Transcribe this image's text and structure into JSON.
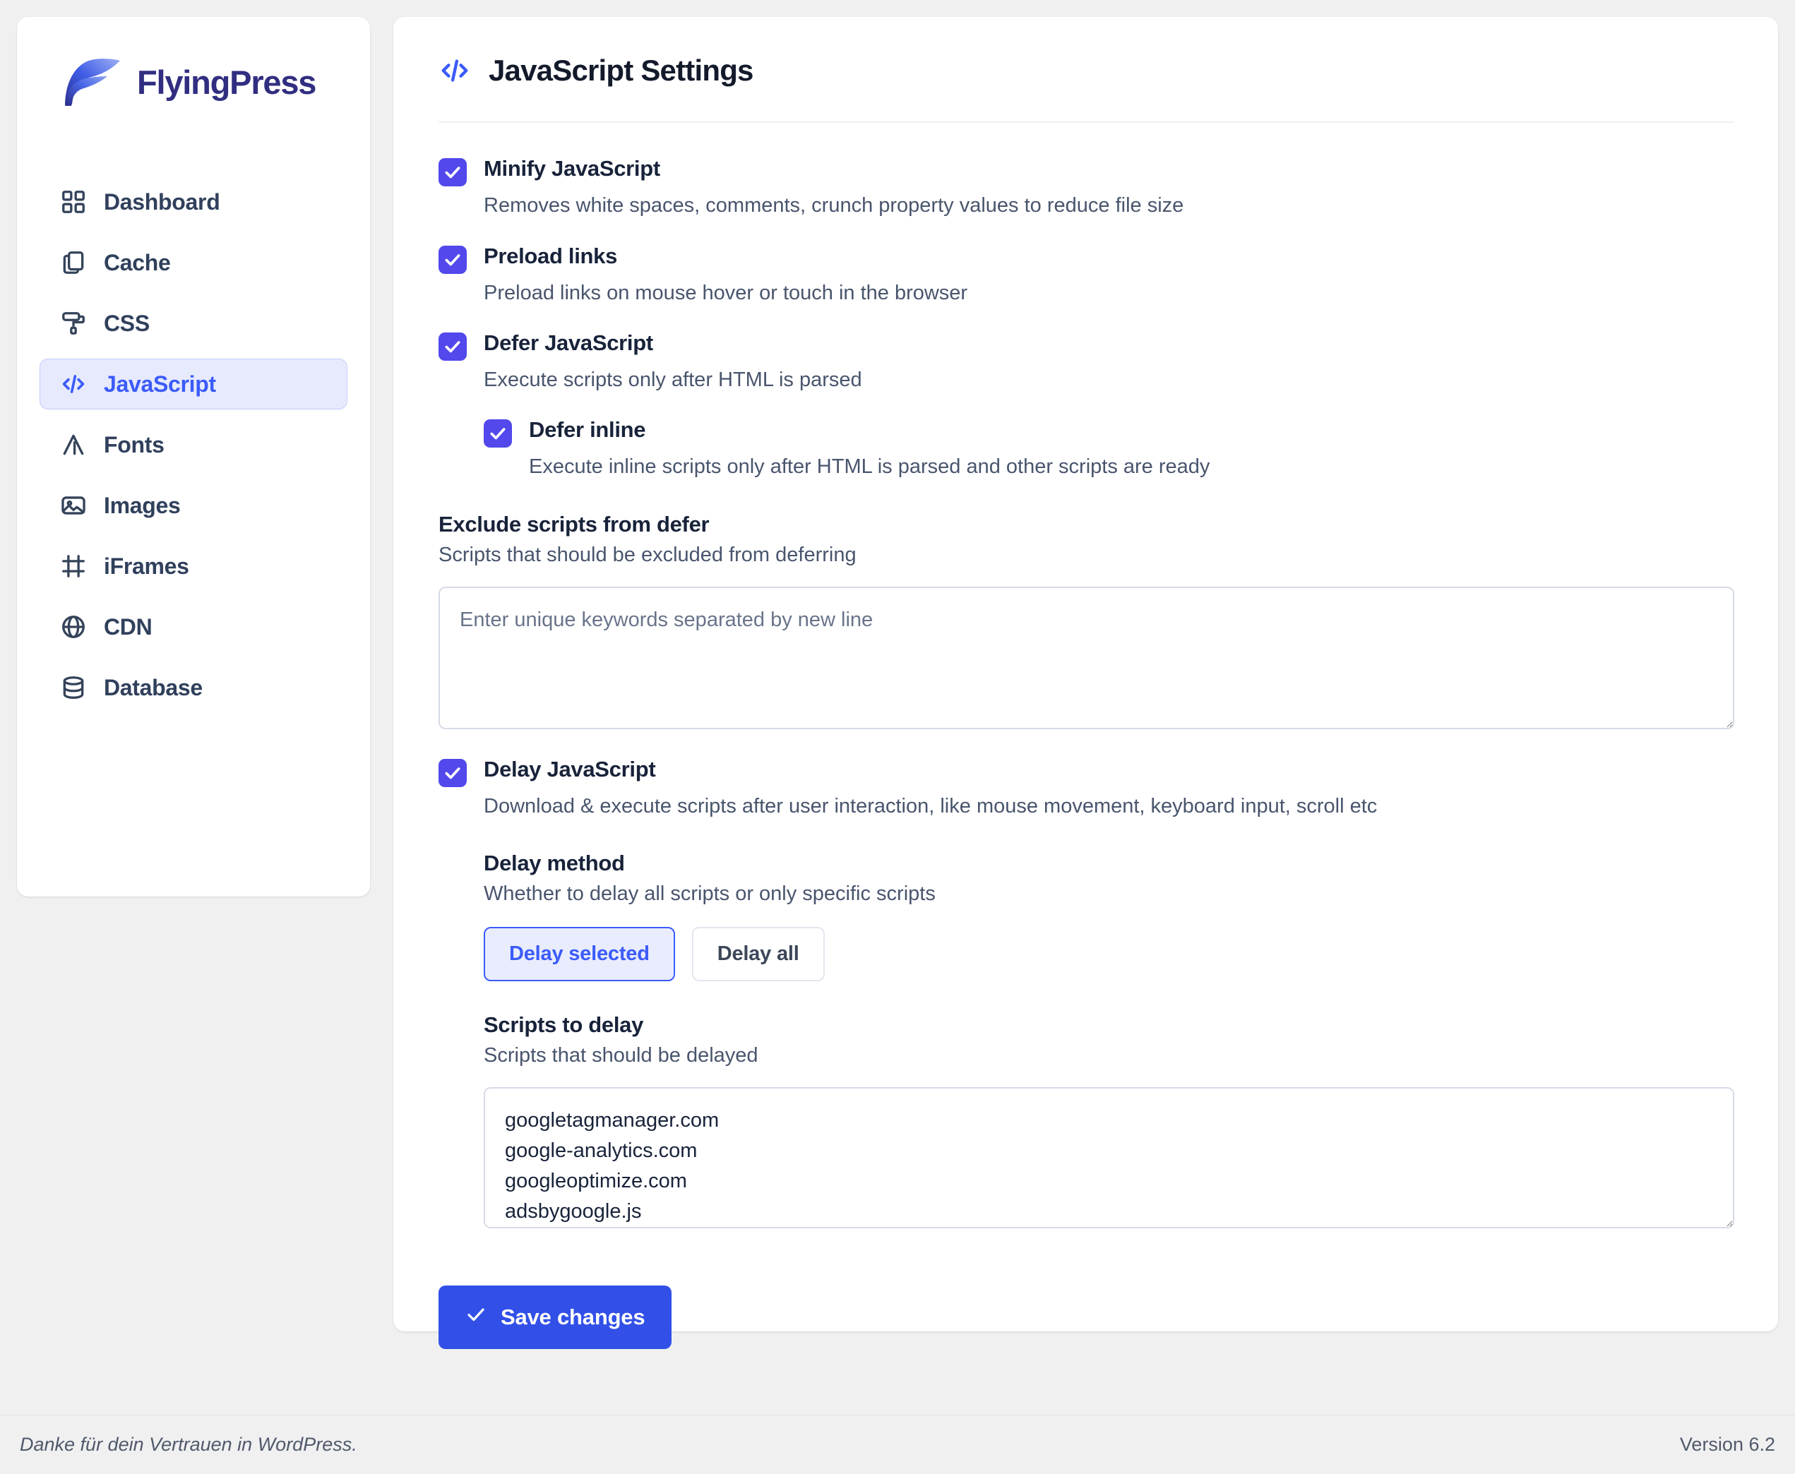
{
  "brand": {
    "name": "FlyingPress",
    "logo_icon": "flyingpress-logo",
    "colors": {
      "logo_dark": "#2b2f8c",
      "logo_mid": "#3f5ce6",
      "logo_light": "#8da2f0"
    }
  },
  "sidebar": {
    "items": [
      {
        "label": "Dashboard",
        "icon": "grid-icon",
        "active": false
      },
      {
        "label": "Cache",
        "icon": "copy-icon",
        "active": false
      },
      {
        "label": "CSS",
        "icon": "paint-roller-icon",
        "active": false
      },
      {
        "label": "JavaScript",
        "icon": "code-brackets-icon",
        "active": true
      },
      {
        "label": "Fonts",
        "icon": "letter-a-icon",
        "active": false
      },
      {
        "label": "Images",
        "icon": "image-icon",
        "active": false
      },
      {
        "label": "iFrames",
        "icon": "frame-icon",
        "active": false
      },
      {
        "label": "CDN",
        "icon": "globe-icon",
        "active": false
      },
      {
        "label": "Database",
        "icon": "database-icon",
        "active": false
      }
    ]
  },
  "panel": {
    "icon": "code-brackets-icon",
    "title": "JavaScript Settings"
  },
  "settings": {
    "minify": {
      "label": "Minify JavaScript",
      "desc": "Removes white spaces, comments, crunch property values to reduce file size",
      "checked": true
    },
    "preload_links": {
      "label": "Preload links",
      "desc": "Preload links on mouse hover or touch in the browser",
      "checked": true
    },
    "defer": {
      "label": "Defer JavaScript",
      "desc": "Execute scripts only after HTML is parsed",
      "checked": true
    },
    "defer_inline": {
      "label": "Defer inline",
      "desc": "Execute inline scripts only after HTML is parsed and other scripts are ready",
      "checked": true
    },
    "exclude_defer": {
      "title": "Exclude scripts from defer",
      "sub": "Scripts that should be excluded from deferring",
      "placeholder": "Enter unique keywords separated by new line",
      "value": ""
    },
    "delay": {
      "label": "Delay JavaScript",
      "desc": "Download & execute scripts after user interaction, like mouse movement, keyboard input, scroll etc",
      "checked": true
    },
    "delay_method": {
      "title": "Delay method",
      "sub": "Whether to delay all scripts or only specific scripts",
      "options": [
        "Delay selected",
        "Delay all"
      ],
      "selected": "Delay selected"
    },
    "scripts_to_delay": {
      "title": "Scripts to delay",
      "sub": "Scripts that should be delayed",
      "value": "googletagmanager.com\ngoogle-analytics.com\ngoogleoptimize.com\nadsbygoogle.js"
    }
  },
  "actions": {
    "save_label": "Save changes",
    "save_icon": "check-icon",
    "save_color": "#3250e8"
  },
  "footer": {
    "left": "Danke für dein Vertrauen in WordPress.",
    "right": "Version 6.2"
  }
}
